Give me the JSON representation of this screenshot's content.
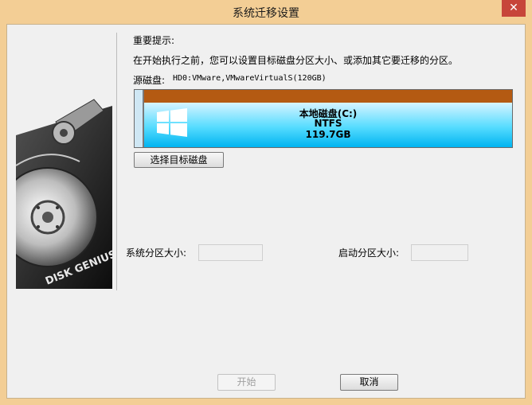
{
  "window": {
    "title": "系统迁移设置",
    "close_glyph": "✕"
  },
  "notice": {
    "heading": "重要提示:",
    "text": "在开始执行之前，您可以设置目标磁盘分区大小、或添加其它要迁移的分区。"
  },
  "source_disk": {
    "label": "源磁盘:",
    "value": "HD0:VMware,VMwareVirtualS(120GB)"
  },
  "partition": {
    "name": "本地磁盘(C:)",
    "filesystem": "NTFS",
    "size": "119.7GB",
    "icon": "windows-logo-icon"
  },
  "buttons": {
    "select_target": "选择目标磁盘",
    "start": "开始",
    "cancel": "取消"
  },
  "fields": {
    "system_partition_size_label": "系统分区大小:",
    "boot_partition_size_label": "启动分区大小:"
  },
  "branding": {
    "art_text": "DISK GENIUS"
  },
  "colors": {
    "partition_fill": "#3fd4ff",
    "disk_top": "#b45a12",
    "frame": "#f3ce95"
  }
}
